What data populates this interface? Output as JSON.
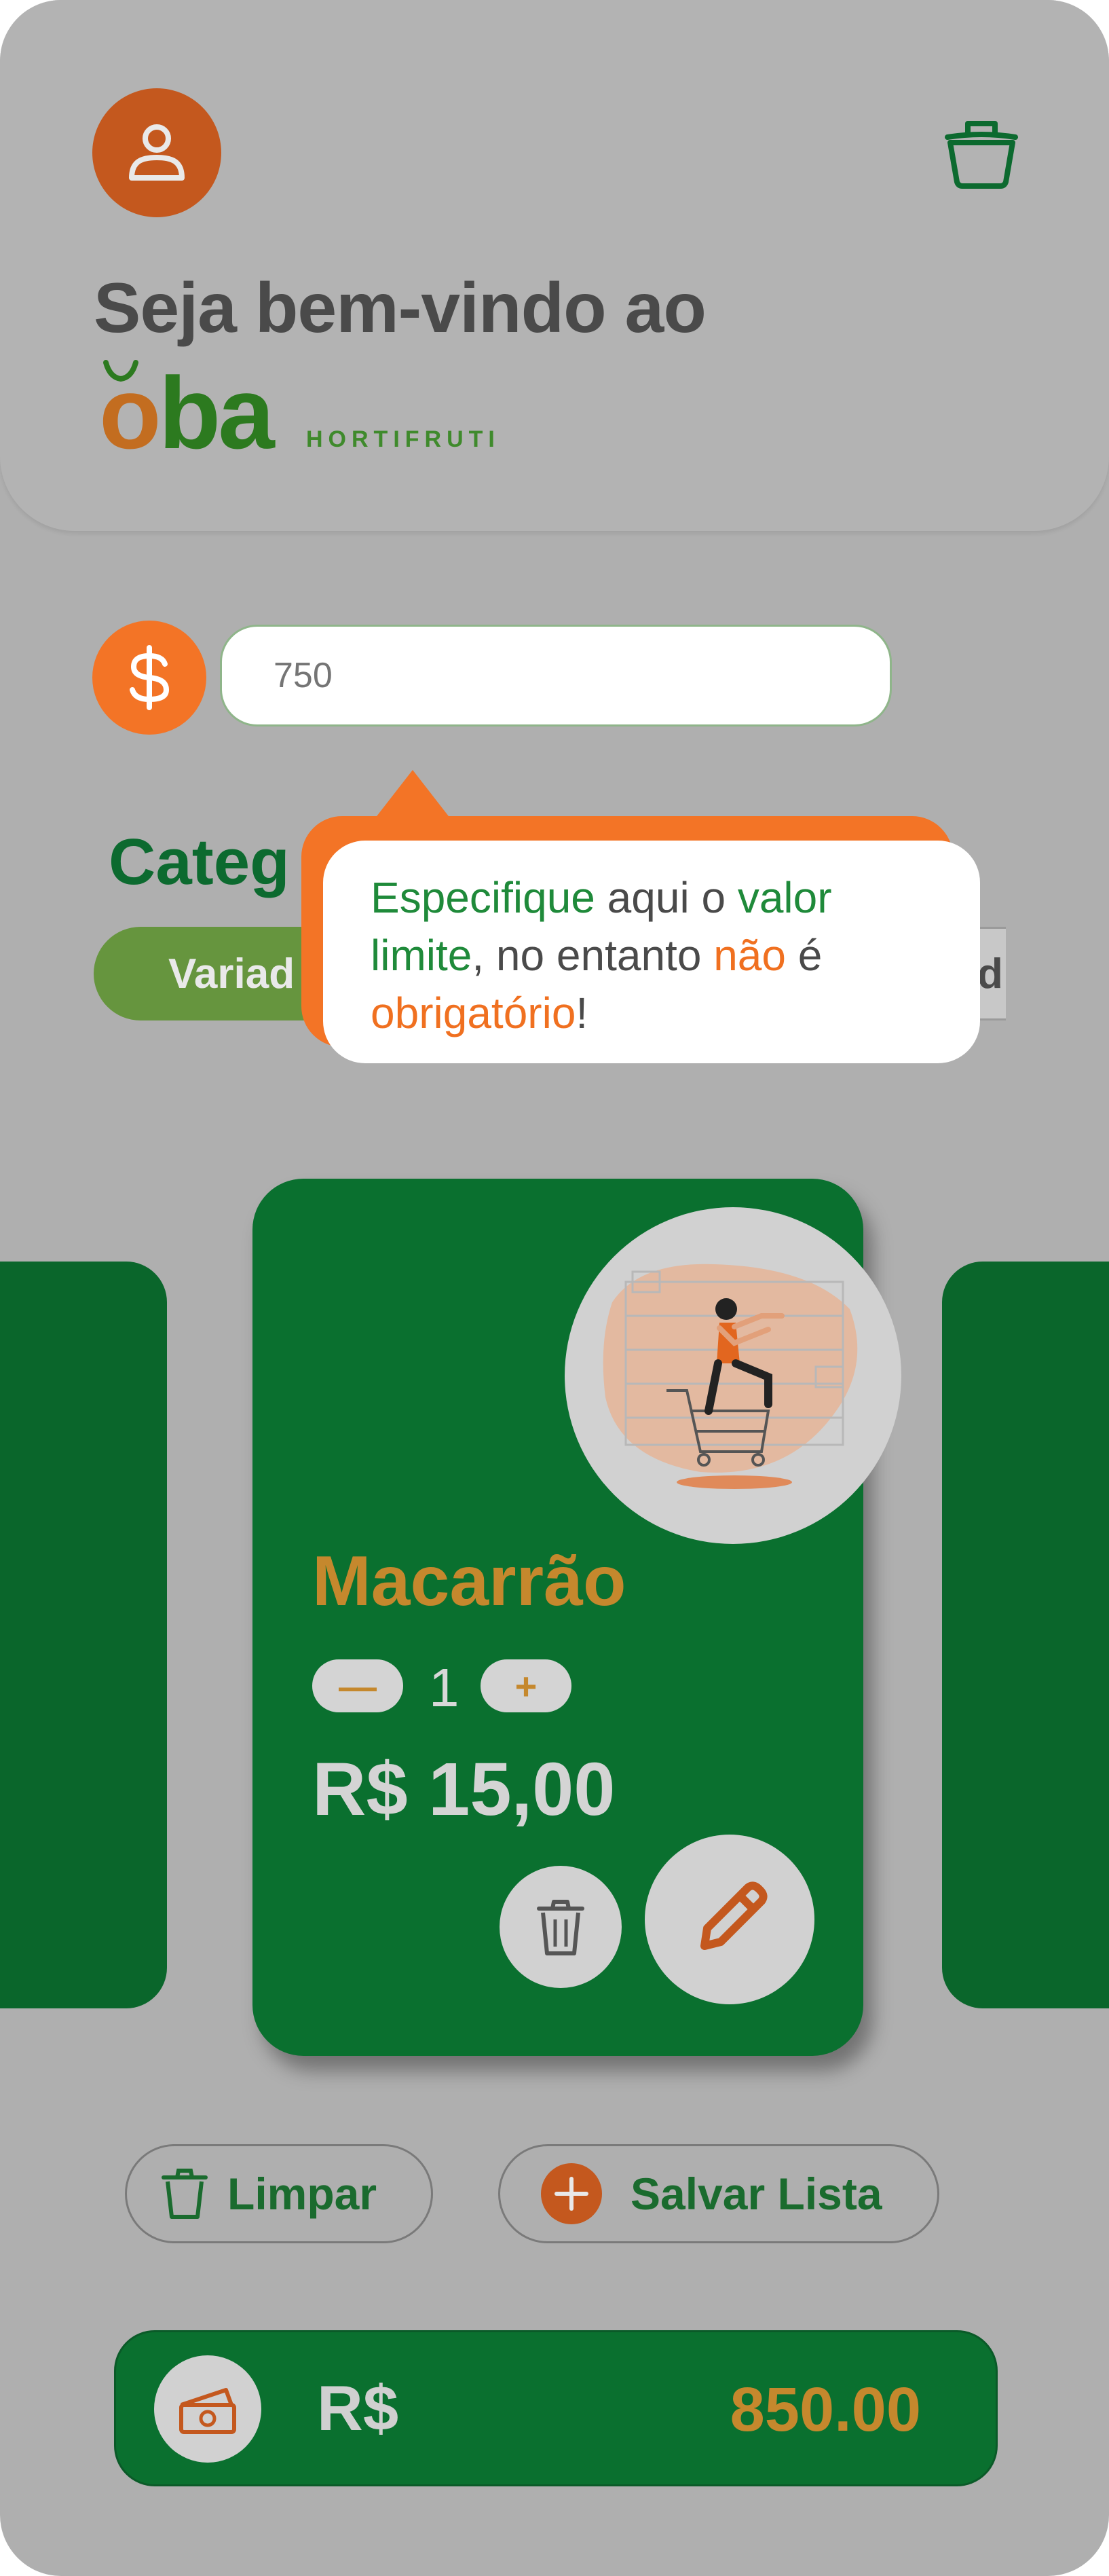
{
  "header": {
    "welcome": "Seja bem-vindo ao",
    "logo_main_o": "o",
    "logo_main_rest": "ba",
    "logo_sub": "HORTIFRUTI"
  },
  "limit": {
    "value": "750",
    "currency_icon": "dollar-icon"
  },
  "categories": {
    "title": "Categ",
    "items": [
      {
        "label": "Variad"
      },
      {
        "label": "d"
      }
    ]
  },
  "tooltip": {
    "parts": [
      {
        "text": "Especifique",
        "style": "g"
      },
      {
        "text": " aqui o ",
        "style": "n"
      },
      {
        "text": "valor limite",
        "style": "g"
      },
      {
        "text": ", no entanto ",
        "style": "n"
      },
      {
        "text": "não",
        "style": "o"
      },
      {
        "text": " é ",
        "style": "n"
      },
      {
        "text": "obrigatório",
        "style": "o"
      },
      {
        "text": "!",
        "style": "n"
      }
    ]
  },
  "product": {
    "name": "Macarrão",
    "decrement_label": "—",
    "quantity": "1",
    "increment_label": "+",
    "price": "R$ 15,00"
  },
  "actions": {
    "clear_label": "Limpar",
    "save_label": "Salvar Lista"
  },
  "total": {
    "currency": "R$",
    "value": "850.00"
  },
  "colors": {
    "primary_green": "#0a702f",
    "accent_orange": "#f37426",
    "brand_rust": "#c4581e",
    "gold": "#c5882d"
  }
}
